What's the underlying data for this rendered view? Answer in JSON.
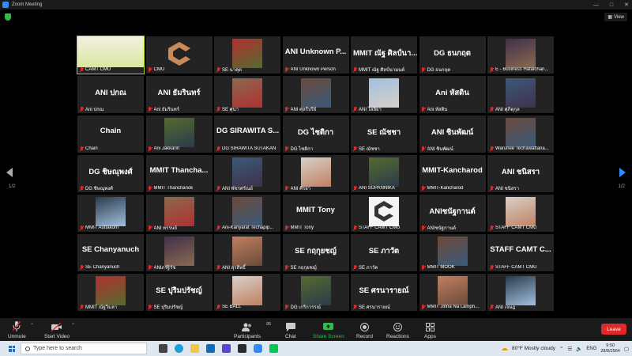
{
  "window": {
    "title": "Zoom Meeting"
  },
  "view_button": {
    "label": "View"
  },
  "pagination": {
    "left": "1/2",
    "right": "1/2"
  },
  "participants_grid": [
    {
      "name": "CAMT CMU",
      "avatar": "",
      "type": "video-slide",
      "active": true
    },
    {
      "name": "CMU",
      "avatar": "",
      "type": "camt-logo"
    },
    {
      "name": "SE นาคุด",
      "avatar": "",
      "type": "photo"
    },
    {
      "name": "ANI Unknown Person",
      "avatar": "ANI Unknown P...",
      "type": "text"
    },
    {
      "name": "MMIT ณัฐ ศิลป์นามนต์",
      "avatar": "MMIT ณัฐ ศิลป์นา...",
      "type": "text"
    },
    {
      "name": "DG ธนกฤต",
      "avatar": "DG ธนกฤต",
      "type": "text"
    },
    {
      "name": "E - Business Hataichan...",
      "avatar": "",
      "type": "photo"
    },
    {
      "name": "Ani ปกณ",
      "avatar": "ANI ปกณ",
      "type": "text"
    },
    {
      "name": "Ani ธัมรินทร์",
      "avatar": "ANI ธัมรินทร์",
      "type": "text"
    },
    {
      "name": "SE ศุนา",
      "avatar": "",
      "type": "photo"
    },
    {
      "name": "ANI ศุลรีปรีย์",
      "avatar": "",
      "type": "anime"
    },
    {
      "name": "ANI ไลลิยา",
      "avatar": "",
      "type": "anime"
    },
    {
      "name": "Ani หัสดิน",
      "avatar": "Ani หัสดิน",
      "type": "text"
    },
    {
      "name": "ANI ศุภิตุกุล",
      "avatar": "",
      "type": "photo"
    },
    {
      "name": "Chain",
      "avatar": "Chain",
      "type": "text"
    },
    {
      "name": "Ani Jakkarin",
      "avatar": "",
      "type": "photo"
    },
    {
      "name": "DG SIRAWITA SUTAKAN",
      "avatar": "DG SIRAWITA S...",
      "type": "text"
    },
    {
      "name": "DG ไชติกา",
      "avatar": "DG ไชติกา",
      "type": "text"
    },
    {
      "name": "SE ณัชชา",
      "avatar": "SE ณัชชา",
      "type": "text"
    },
    {
      "name": "ANI ชินพัฒน์",
      "avatar": "ANI ชินพัฒน์",
      "type": "text"
    },
    {
      "name": "Warunee Techawattana...",
      "avatar": "",
      "type": "photo"
    },
    {
      "name": "DG ชิษณุพงศ์",
      "avatar": "DG ชิษณุพงศ์",
      "type": "text"
    },
    {
      "name": "MMIT Thanchanok",
      "avatar": "MMIT Thancha...",
      "type": "text"
    },
    {
      "name": "ANI พัชรศรัณย์",
      "avatar": "",
      "type": "photo"
    },
    {
      "name": "ANI ศิรยา",
      "avatar": "",
      "type": "photo"
    },
    {
      "name": "ANI SUPANNIKA",
      "avatar": "",
      "type": "anime"
    },
    {
      "name": "MMIT-Kancharod",
      "avatar": "MMIT-Kancharod",
      "type": "text"
    },
    {
      "name": "ANI ชนิสรา",
      "avatar": "ANI ชนิสรา",
      "type": "text"
    },
    {
      "name": "MMIT Auttakorn",
      "avatar": "",
      "type": "photo"
    },
    {
      "name": "ANI ทรรษย์",
      "avatar": "",
      "type": "photo"
    },
    {
      "name": "Ani-Kanyarat Techapip...",
      "avatar": "",
      "type": "anime"
    },
    {
      "name": "MMIT Tony",
      "avatar": "MMIT Tony",
      "type": "text"
    },
    {
      "name": "STAFF CAMT CMU",
      "avatar": "",
      "type": "camt-logo-light"
    },
    {
      "name": "ANIชนัฐกานต์",
      "avatar": "ANIชนัฐกานต์",
      "type": "text"
    },
    {
      "name": "STAFF CAMT CMU",
      "avatar": "",
      "type": "anime"
    },
    {
      "name": "SE Chanyanuch",
      "avatar": "SE Chanyanuch",
      "type": "text"
    },
    {
      "name": "ANIภรัฐิรัช",
      "avatar": "",
      "type": "anime"
    },
    {
      "name": "ANI สุรสิทธิ์",
      "avatar": "",
      "type": "photo"
    },
    {
      "name": "SE กฤกุยชญ์",
      "avatar": "SE กฤกุยชญ์",
      "type": "text"
    },
    {
      "name": "SE ภาวัต",
      "avatar": "SE ภาวัต",
      "type": "text"
    },
    {
      "name": "MMIT MOOK",
      "avatar": "",
      "type": "anime"
    },
    {
      "name": "STAFF CAMT CMU",
      "avatar": "STAFF CAMT C...",
      "type": "text"
    },
    {
      "name": "MMIT ณัฐวิมลา",
      "avatar": "",
      "type": "photo"
    },
    {
      "name": "SE ปุริมปรัชญ์",
      "avatar": "SE ปุริมปรัชญ์",
      "type": "text"
    },
    {
      "name": "SE BALL",
      "avatar": "",
      "type": "photo"
    },
    {
      "name": "DG เกริกวรรณ์",
      "avatar": "",
      "type": "photo"
    },
    {
      "name": "SE ศรนารายณ์",
      "avatar": "SE ศรนารายณ์",
      "type": "text"
    },
    {
      "name": "MMIT Jinna Na Lamph...",
      "avatar": "",
      "type": "anime"
    },
    {
      "name": "ANI เจษฎ",
      "avatar": "",
      "type": "anime"
    }
  ],
  "controls": {
    "unmute": "Unmute",
    "start_video": "Start Video",
    "participants": "Participants",
    "participants_count": "95",
    "chat": "Chat",
    "share_screen": "Share Screen",
    "record": "Record",
    "reactions": "Reactions",
    "apps": "Apps",
    "leave": "Leave"
  },
  "taskbar": {
    "search_placeholder": "Type here to search",
    "weather": "80°F  Mostly cloudy",
    "time": "9:50",
    "date": "28/8/2564"
  }
}
